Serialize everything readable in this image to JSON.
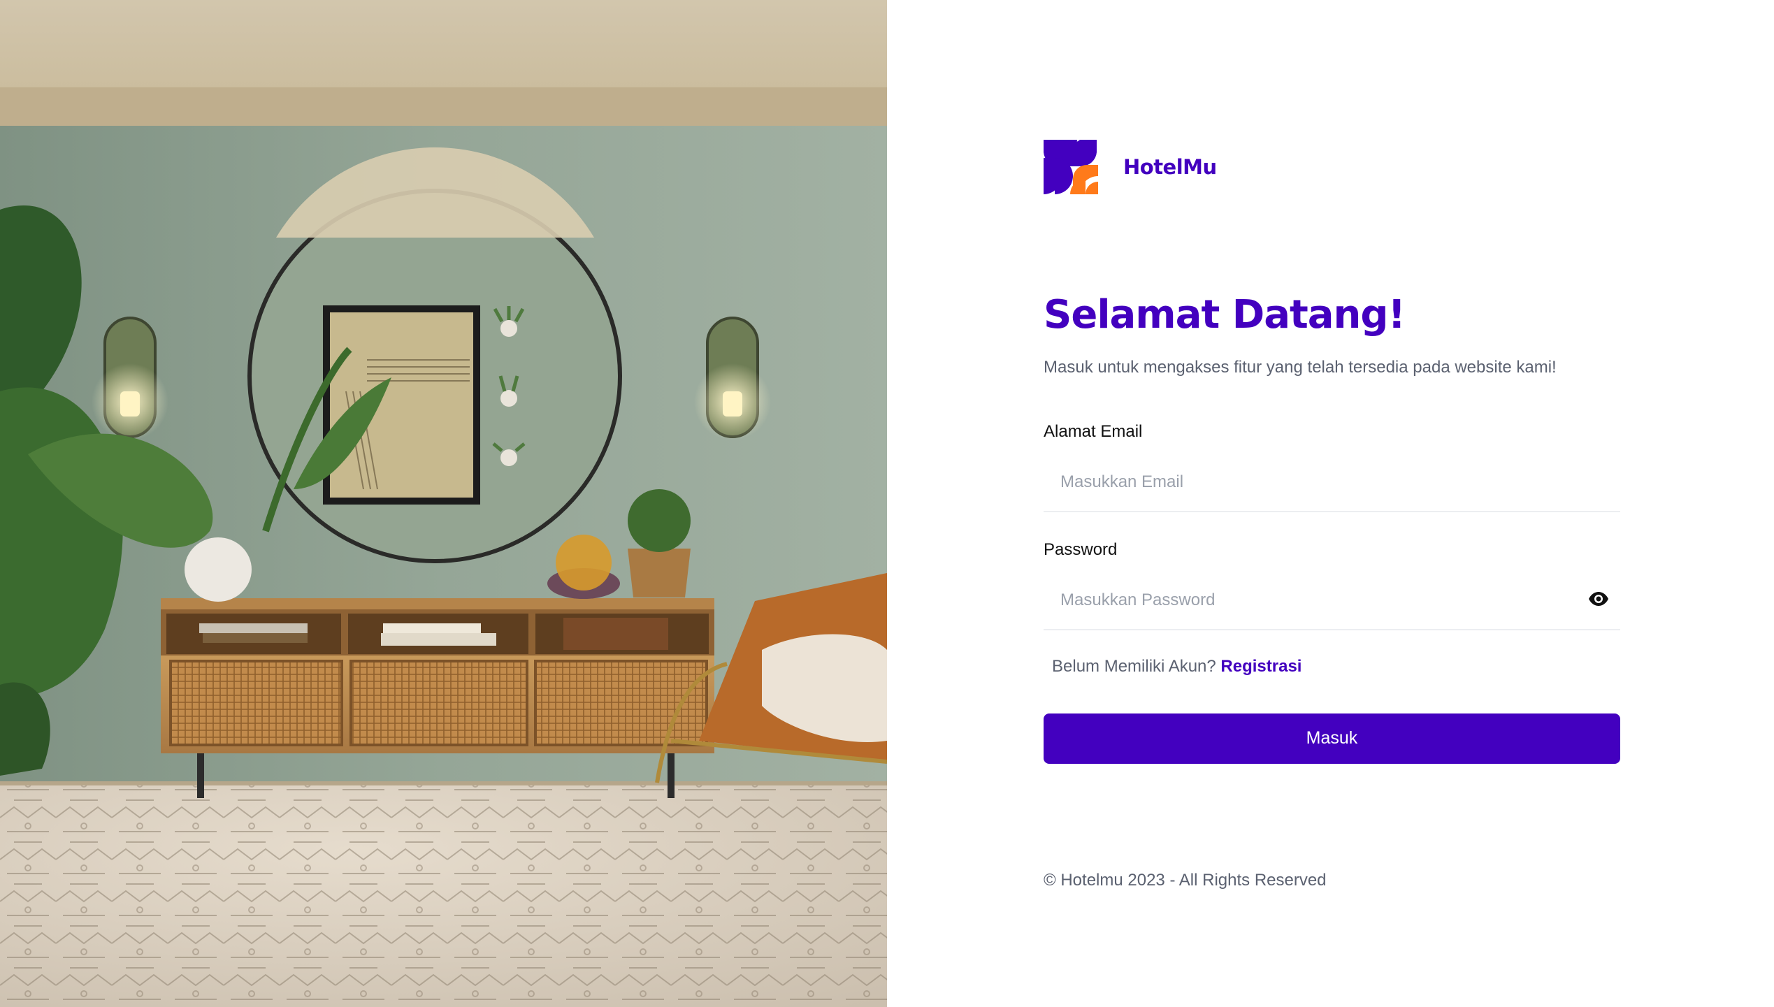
{
  "brand": {
    "name": "HotelMu",
    "colors": {
      "primary": "#4300BF",
      "accent": "#FF7A1A"
    }
  },
  "photo": {
    "alt": "Living room interior with round mirror, plants and rattan sideboard"
  },
  "login": {
    "title": "Selamat Datang!",
    "subtitle": "Masuk untuk mengakses fitur yang telah tersedia pada website kami!",
    "email": {
      "label": "Alamat Email",
      "placeholder": "Masukkan Email",
      "value": ""
    },
    "password": {
      "label": "Password",
      "placeholder": "Masukkan Password",
      "value": "",
      "toggle_icon": "eye-icon"
    },
    "register": {
      "prompt": "Belum Memiliki Akun?",
      "link": "Registrasi"
    },
    "submit_label": "Masuk"
  },
  "footer": {
    "text": "© Hotelmu 2023 - All Rights Reserved"
  }
}
